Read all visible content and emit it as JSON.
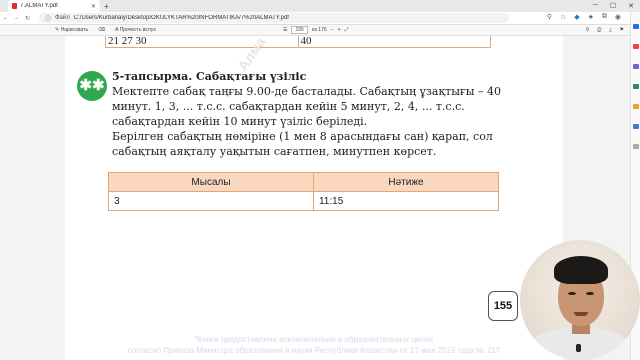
{
  "browser": {
    "tab_title": "7.ALMATY.pdf",
    "new_tab": "+",
    "file_label": "Файл",
    "url": "C:/Users/Kurbanaly/Desktop/OKULYKTAR%20INFORMATIKA/7%20ALMATY.pdf"
  },
  "pdf_toolbar": {
    "draw_label": "Нарисовать",
    "read_aloud_label": "Прочесть вслух",
    "current_page": "155",
    "page_total": "из 176"
  },
  "page": {
    "top_table": {
      "left": "21  27  30",
      "right": "40"
    },
    "watermark": "Алма",
    "badge_text": "**\n*",
    "task_title": "5-тапсырма. Сабақтағы үзіліс",
    "paragraph1": "Мектепте сабақ таңғы 9.00-де басталады. Сабақтың ұзақтығы – 40 минут. 1, 3, ... т.с.с. сабақтардан кейін 5 минут, 2, 4, ... т.с.с. сабақтардан кейін 10 минут үзіліс беріледі.",
    "paragraph2": "Берілген сабақтың нөміріне (1 мен 8 арасындағы сан) қарап, сол сабақтың аяқталу уақытын сағатпен, минутпен көрсет.",
    "example_table": {
      "headers": [
        "Мысалы",
        "Нәтиже"
      ],
      "row": [
        "3",
        "11:15"
      ]
    },
    "page_number": "155",
    "footer_line1": "*Книга предоставлена исключительно в образовательных целях",
    "footer_line2": "согласно Приказа Министра образования и науки Республики Казахстан от 17 мая 2019 года № 217"
  }
}
